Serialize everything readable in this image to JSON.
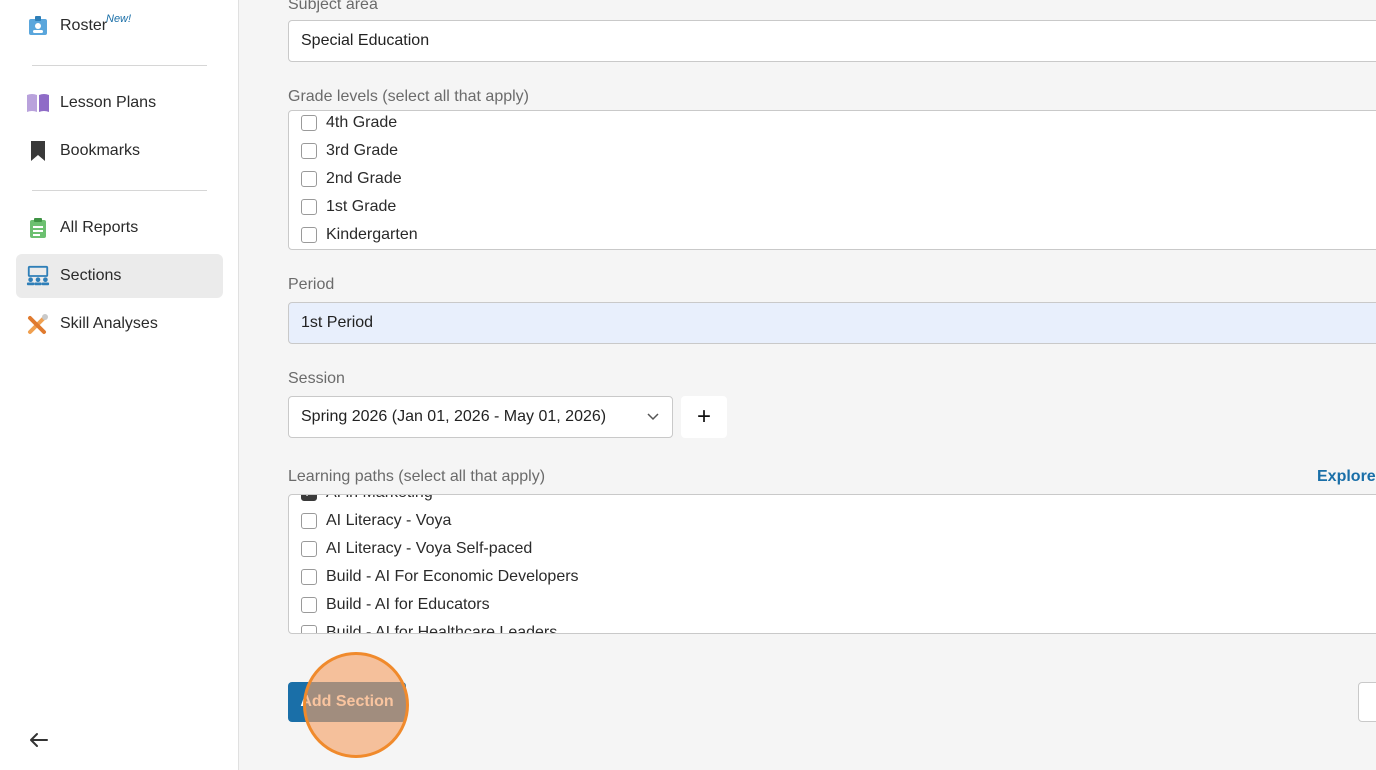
{
  "sidebar": {
    "roster": {
      "label": "Roster",
      "badge": "New!"
    },
    "lesson_plans": {
      "label": "Lesson Plans"
    },
    "bookmarks": {
      "label": "Bookmarks"
    },
    "all_reports": {
      "label": "All Reports"
    },
    "sections": {
      "label": "Sections",
      "active": true
    },
    "skill_analyses": {
      "label": "Skill Analyses"
    }
  },
  "form": {
    "subject_area": {
      "label": "Subject area",
      "value": "Special Education"
    },
    "grade_levels": {
      "label": "Grade levels (select all that apply)",
      "options": [
        {
          "label": "4th Grade",
          "checked": false
        },
        {
          "label": "3rd Grade",
          "checked": false
        },
        {
          "label": "2nd Grade",
          "checked": false
        },
        {
          "label": "1st Grade",
          "checked": false
        },
        {
          "label": "Kindergarten",
          "checked": false
        }
      ]
    },
    "period": {
      "label": "Period",
      "value": "1st Period"
    },
    "session": {
      "label": "Session",
      "value": "Spring 2026 (Jan 01, 2026 - May 01, 2026)",
      "add_label": "+"
    },
    "learning_paths": {
      "label": "Learning paths (select all that apply)",
      "explore_label": "Explore",
      "options": [
        {
          "label": "AI in Marketing",
          "checked": true
        },
        {
          "label": "AI Literacy - Voya",
          "checked": false
        },
        {
          "label": "AI Literacy - Voya Self-paced",
          "checked": false
        },
        {
          "label": "Build - AI For Economic Developers",
          "checked": false
        },
        {
          "label": "Build - AI for Educators",
          "checked": false
        },
        {
          "label": "Build - AI for Healthcare Leaders",
          "checked": false
        }
      ]
    },
    "submit_label": "Add Section"
  },
  "colors": {
    "accent": "#1a6fa8",
    "click_highlight": "#f08a2c"
  }
}
